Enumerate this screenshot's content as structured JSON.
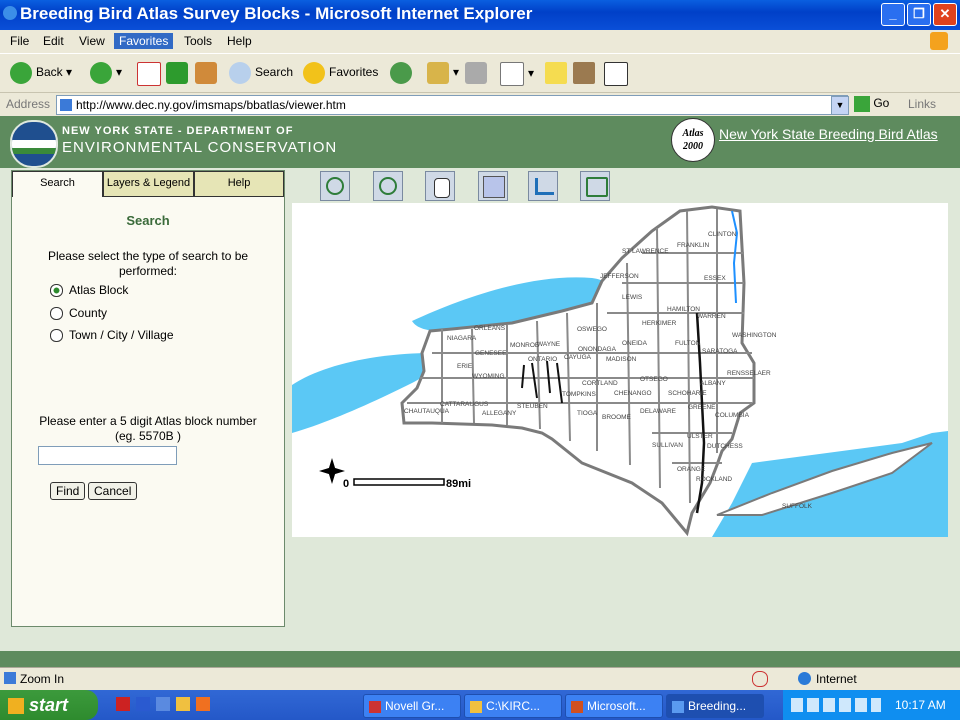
{
  "window": {
    "title": "Breeding Bird Atlas Survey Blocks - Microsoft Internet Explorer"
  },
  "menu": {
    "items": [
      "File",
      "Edit",
      "View",
      "Favorites",
      "Tools",
      "Help"
    ]
  },
  "toolbar": {
    "back": "Back",
    "search": "Search",
    "favorites": "Favorites"
  },
  "address": {
    "label": "Address",
    "url": "http://www.dec.ny.gov/imsmaps/bbatlas/viewer.htm",
    "go": "Go",
    "links": "Links"
  },
  "header": {
    "agency_line1": "NEW YORK STATE - DEPARTMENT OF",
    "agency_line2": "ENVIRONMENTAL CONSERVATION",
    "atlas_badge_line1": "Atlas",
    "atlas_badge_line2": "2000",
    "atlas_link": "New York State Breeding Bird Atlas"
  },
  "panel": {
    "tabs": [
      "Search",
      "Layers & Legend",
      "Help"
    ],
    "heading": "Search",
    "prompt": "Please select the type of search to be performed:",
    "options": [
      "Atlas Block",
      "County",
      "Town / City / Village"
    ],
    "selected": "Atlas Block",
    "block_prompt": "Please enter a 5 digit Atlas block number (eg. 5570B )",
    "block_value": "",
    "find": "Find",
    "cancel": "Cancel"
  },
  "map": {
    "scale_start": "0",
    "scale_end": "89mi",
    "counties": [
      "ST LAWRENCE",
      "FRANKLIN",
      "CLINTON",
      "ESSEX",
      "JEFFERSON",
      "LEWIS",
      "HAMILTON",
      "WARREN",
      "OSWEGO",
      "HERKIMER",
      "FULTON",
      "SARATOGA",
      "WASHINGTON",
      "ORLEANS",
      "NIAGARA",
      "MONROE",
      "WAYNE",
      "GENESEE",
      "ONONDAGA",
      "MADISON",
      "ONEIDA",
      "ERIE",
      "WYOMING",
      "ONTARIO",
      "CAYUGA",
      "CORTLAND",
      "OTSEGO",
      "SCHOHARIE",
      "ALBANY",
      "RENSSELAER",
      "CHAUTAUQUA",
      "CATTARAUGUS",
      "ALLEGANY",
      "STEUBEN",
      "TOMPKINS",
      "TIOGA",
      "BROOME",
      "CHENANGO",
      "DELAWARE",
      "GREENE",
      "COLUMBIA",
      "ULSTER",
      "DUTCHESS",
      "SULLIVAN",
      "ORANGE",
      "ROCKLAND",
      "SUFFOLK"
    ]
  },
  "status": {
    "left": "Zoom In",
    "zone": "Internet"
  },
  "taskbar": {
    "start": "start",
    "tasks": [
      "Novell Gr...",
      "C:\\KIRC...",
      "Microsoft...",
      "Breeding..."
    ],
    "clock": "10:17 AM"
  },
  "colors": {
    "water": "#5bc8f5",
    "land_border": "#808080",
    "header_green": "#5e8b5e"
  }
}
